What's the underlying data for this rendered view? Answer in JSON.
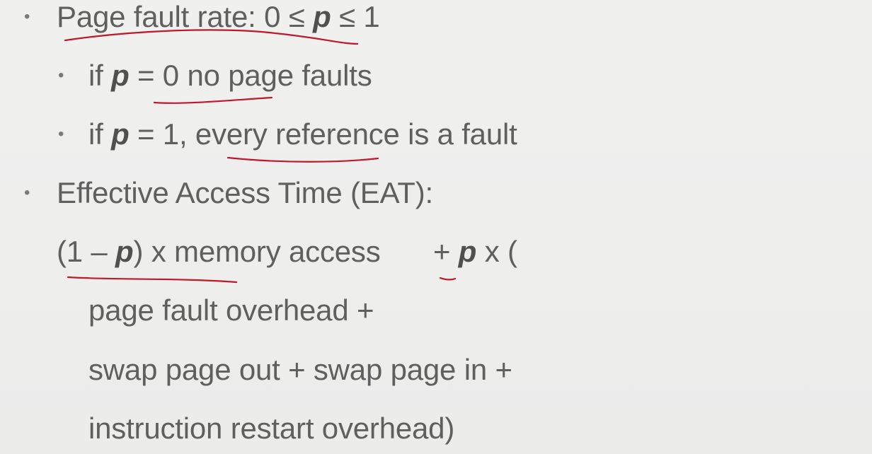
{
  "bullet_glyph": "•",
  "lines": {
    "l1": {
      "a": "Page fault rate: 0 ≤ ",
      "var": "p",
      "b": " ≤ 1"
    },
    "l2": {
      "a": "if ",
      "var": "p",
      "b": " = 0 no page faults"
    },
    "l3": {
      "a": "if ",
      "var": "p",
      "b": " = 1, every reference is a fault"
    },
    "l4": {
      "text": "Effective Access Time (EAT):"
    },
    "l5": {
      "a": "(1 – ",
      "var": "p",
      "b": ") x memory access",
      "c": "+ ",
      "var2": "p",
      "d": " x ("
    },
    "l6": {
      "text": "page fault overhead +"
    },
    "l7": {
      "text": "swap page out + swap page in +"
    },
    "l8": {
      "text": "instruction restart overhead)"
    }
  },
  "colors": {
    "text": "#5f5f5f",
    "annotation": "#c0172b",
    "background": "#efefee"
  }
}
